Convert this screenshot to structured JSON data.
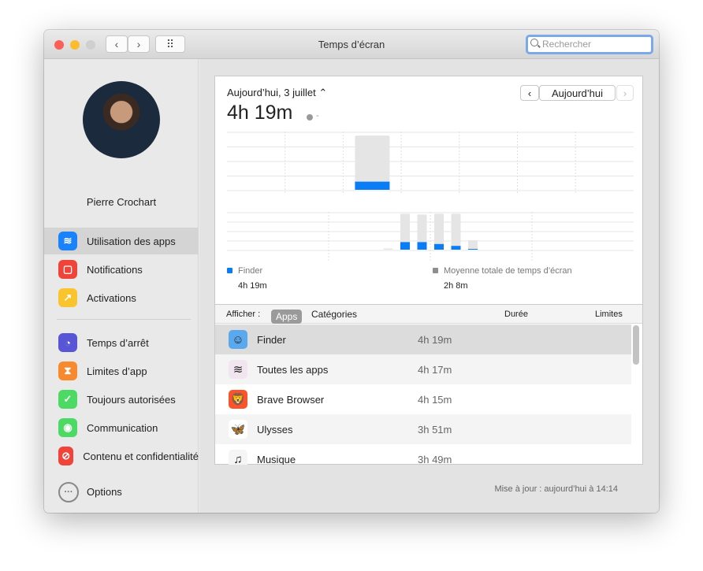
{
  "window": {
    "title": "Temps d’écran",
    "search_placeholder": "Rechercher",
    "nav_back": "‹",
    "nav_forward": "›",
    "grid_icon": "⠿"
  },
  "sidebar": {
    "user": "Pierre Crochart",
    "items": [
      {
        "label": "Utilisation des apps",
        "icon": "layers-icon",
        "color": "#1a82fb",
        "glyph": "≋",
        "selected": true
      },
      {
        "label": "Notifications",
        "icon": "notification-icon",
        "color": "#f0443a",
        "glyph": "▢"
      },
      {
        "label": "Activations",
        "icon": "pickup-icon",
        "color": "#f9c42e",
        "glyph": "↗"
      },
      {
        "label": "Temps d’arrêt",
        "icon": "downtime-icon",
        "color": "#5856d6",
        "glyph": "◔"
      },
      {
        "label": "Limites d’app",
        "icon": "hourglass-icon",
        "color": "#f7892e",
        "glyph": "⧗"
      },
      {
        "label": "Toujours autorisées",
        "icon": "checkmark-badge-icon",
        "color": "#4cd964",
        "glyph": "✓"
      },
      {
        "label": "Communication",
        "icon": "person-circle-icon",
        "color": "#4cd964",
        "glyph": "◉"
      },
      {
        "label": "Contenu et confidentialité",
        "icon": "prohibited-icon",
        "color": "#f0443a",
        "glyph": "⊘"
      }
    ],
    "options": "Options"
  },
  "summary": {
    "date": "Aujourd’hui, 3 juillet ⌃",
    "total": "4h 19m",
    "change": "-",
    "today_button": "Aujourd’hui",
    "prev": "‹",
    "next": "›"
  },
  "colors": {
    "app": "#0a7cf5",
    "total": "#e5e5e5",
    "average": "#8e8e8e"
  },
  "daily_chart": {
    "days": [
      {
        "total": 0,
        "app": 0
      },
      {
        "total": 0,
        "app": 0
      },
      {
        "total": 0.93,
        "app": 0.14
      },
      {
        "total": 0,
        "app": 0
      },
      {
        "total": 0,
        "app": 0
      },
      {
        "total": 0,
        "app": 0
      },
      {
        "total": 0,
        "app": 0
      }
    ]
  },
  "hourly_chart": {
    "bars": [
      {
        "h": 9,
        "total": 0.03,
        "app": 0
      },
      {
        "h": 10,
        "total": 0.95,
        "app": 0.2
      },
      {
        "h": 11,
        "total": 0.93,
        "app": 0.2
      },
      {
        "h": 12,
        "total": 0.95,
        "app": 0.15
      },
      {
        "h": 13,
        "total": 0.95,
        "app": 0.1
      },
      {
        "h": 14,
        "total": 0.25,
        "app": 0.02
      }
    ]
  },
  "legend": [
    {
      "label": "Finder",
      "value": "4h 19m",
      "color": "#0a7cf5"
    },
    {
      "label": "Moyenne totale de temps d’écran",
      "value": "2h 8m",
      "color": "#8e8e8e"
    }
  ],
  "table": {
    "show_label": "Afficher :",
    "tab_apps": "Apps",
    "tab_categories": "Catégories",
    "col_duration": "Durée",
    "col_limits": "Limites",
    "rows": [
      {
        "name": "Finder",
        "duration": "4h 19m",
        "icon": "finder-icon",
        "glyph": "☺",
        "bg": "#5aa8ee"
      },
      {
        "name": "Toutes les apps",
        "duration": "4h 17m",
        "icon": "all-apps-icon",
        "glyph": "≋",
        "bg": "#f1e6f0"
      },
      {
        "name": "Brave Browser",
        "duration": "4h 15m",
        "icon": "brave-icon",
        "glyph": "🦁",
        "bg": "#fb542b"
      },
      {
        "name": "Ulysses",
        "duration": "3h 51m",
        "icon": "ulysses-icon",
        "glyph": "🦋",
        "bg": "#fff"
      },
      {
        "name": "Musique",
        "duration": "3h 49m",
        "icon": "music-icon",
        "glyph": "♫",
        "bg": "#f5f5f5"
      }
    ]
  },
  "footer": "Mise à jour : aujourd’hui à 14:14"
}
